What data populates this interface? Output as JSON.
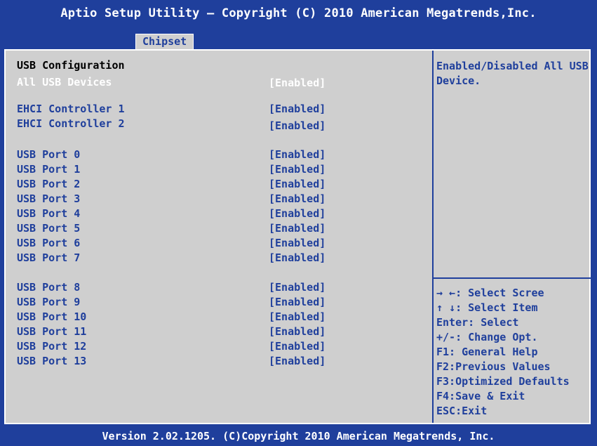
{
  "header": {
    "title": "Aptio Setup Utility – Copyright (C) 2010 American Megatrends,Inc."
  },
  "tab": {
    "label": "Chipset"
  },
  "section": {
    "heading": "USB Configuration"
  },
  "settings": [
    {
      "label": "All USB Devices",
      "value": "[Enabled]",
      "selected": true
    },
    {
      "label": "EHCI Controller 1",
      "value": "[Enabled]"
    },
    {
      "label": "EHCI Controller 2",
      "value": "[Enabled]"
    },
    {
      "label": "USB Port 0",
      "value": "[Enabled]"
    },
    {
      "label": "USB Port 1",
      "value": "[Enabled]"
    },
    {
      "label": "USB Port 2",
      "value": "[Enabled]"
    },
    {
      "label": "USB Port 3",
      "value": "[Enabled]"
    },
    {
      "label": "USB Port 4",
      "value": "[Enabled]"
    },
    {
      "label": "USB Port 5",
      "value": "[Enabled]"
    },
    {
      "label": "USB Port 6",
      "value": "[Enabled]"
    },
    {
      "label": "USB Port 7",
      "value": "[Enabled]"
    },
    {
      "label": "USB Port 8",
      "value": "[Enabled]"
    },
    {
      "label": "USB Port 9",
      "value": "[Enabled]"
    },
    {
      "label": "USB Port 10",
      "value": "[Enabled]"
    },
    {
      "label": "USB Port 11",
      "value": "[Enabled]"
    },
    {
      "label": "USB Port 12",
      "value": "[Enabled]"
    },
    {
      "label": "USB Port 13",
      "value": "[Enabled]"
    }
  ],
  "help": {
    "text": "Enabled/Disabled All USB Device."
  },
  "keys": [
    "→ ←:  Select Scree",
    "↑ ↓:  Select Item",
    "Enter: Select",
    "+/-:  Change Opt.",
    "F1: General Help",
    "F2:Previous Values",
    "F3:Optimized Defaults",
    "F4:Save & Exit",
    "ESC:Exit"
  ],
  "footer": {
    "text": "Version 2.02.1205. (C)Copyright 2010 American Megatrends, Inc."
  },
  "colors": {
    "background": "#1f3f9c",
    "panel": "#cfcfcf",
    "text": "#1f3f9c",
    "highlight": "#ffffff"
  }
}
